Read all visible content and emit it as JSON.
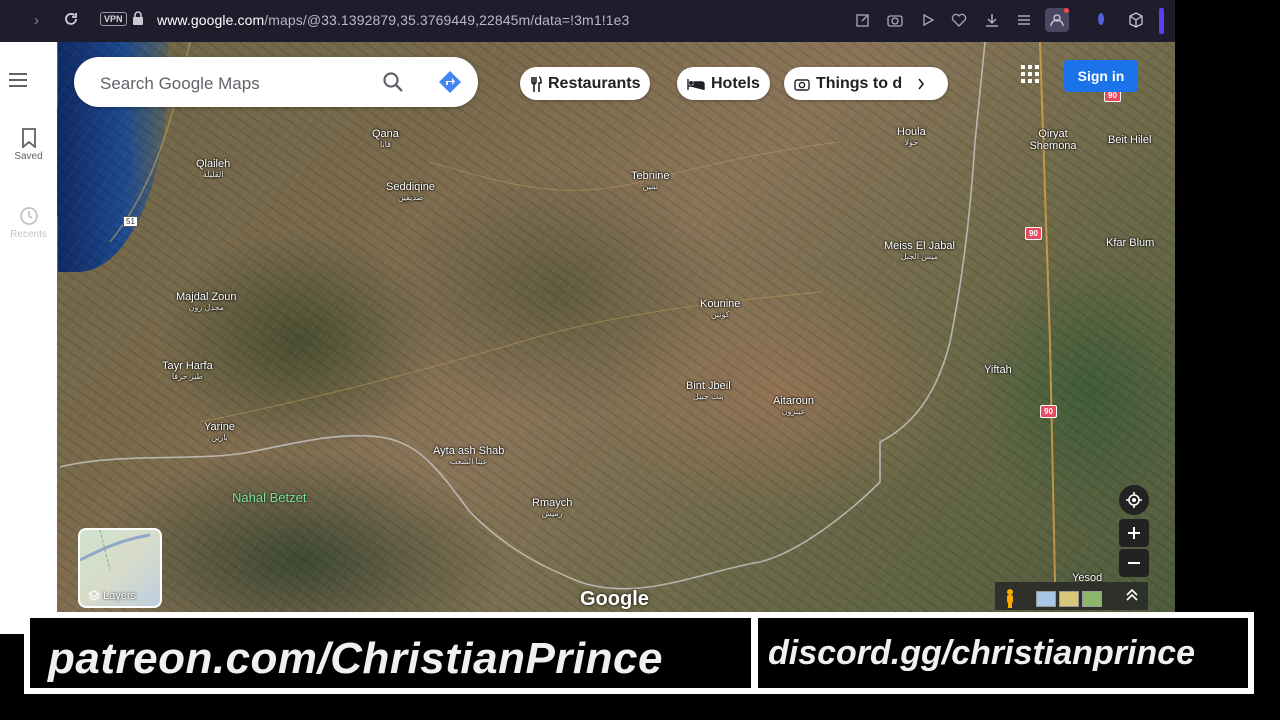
{
  "browser": {
    "vpn_badge": "VPN",
    "url_domain": "www.google.com",
    "url_path": "/maps/@33.1392879,35.3769449,22845m/data=!3m1!1e3"
  },
  "maps": {
    "search_placeholder": "Search Google Maps",
    "chips": [
      "Restaurants",
      "Hotels",
      "Things to d"
    ],
    "signin_label": "Sign in",
    "sidebar": {
      "saved": "Saved",
      "recents": "Recents"
    },
    "layers_label": "Layers",
    "logo": "Google",
    "places": [
      {
        "name": "Qana",
        "ar": "قانا"
      },
      {
        "name": "Seddiqine",
        "ar": "صديقين"
      },
      {
        "name": "Qlaileh",
        "ar": "القليلة"
      },
      {
        "name": "Tebnine",
        "ar": "تبنين"
      },
      {
        "name": "Houla",
        "ar": "حولا"
      },
      {
        "name": "Qiryat Shemona",
        "ar": ""
      },
      {
        "name": "Beit Hilel",
        "ar": ""
      },
      {
        "name": "Meiss El Jabal",
        "ar": "ميس الجبل"
      },
      {
        "name": "Kfar Blum",
        "ar": ""
      },
      {
        "name": "Majdal Zoun",
        "ar": "مجدل زون"
      },
      {
        "name": "Kounine",
        "ar": "كونين"
      },
      {
        "name": "Tayr Harfa",
        "ar": "طير حرفا"
      },
      {
        "name": "Yiftah",
        "ar": ""
      },
      {
        "name": "Bint Jbeil",
        "ar": "بنت جبيل"
      },
      {
        "name": "Aitaroun",
        "ar": "عيترون"
      },
      {
        "name": "Yarine",
        "ar": "يارين"
      },
      {
        "name": "Ayta ash Shab",
        "ar": "عيتا الشعب"
      },
      {
        "name": "Rmaych",
        "ar": "رميش"
      },
      {
        "name": "Yesod",
        "ar": ""
      }
    ],
    "nature_label": "Nahal Betzet",
    "road_shields": [
      "90",
      "90",
      "90",
      "51"
    ]
  },
  "overlay": {
    "patreon": "patreon.com/ChristianPrince",
    "discord": "discord.gg/christianprince"
  },
  "colors": {
    "signin_blue": "#1a73e8",
    "directions_blue": "#4285f4",
    "road_shield_red": "#e84a5f",
    "browser_bg": "#1e1d2b"
  }
}
